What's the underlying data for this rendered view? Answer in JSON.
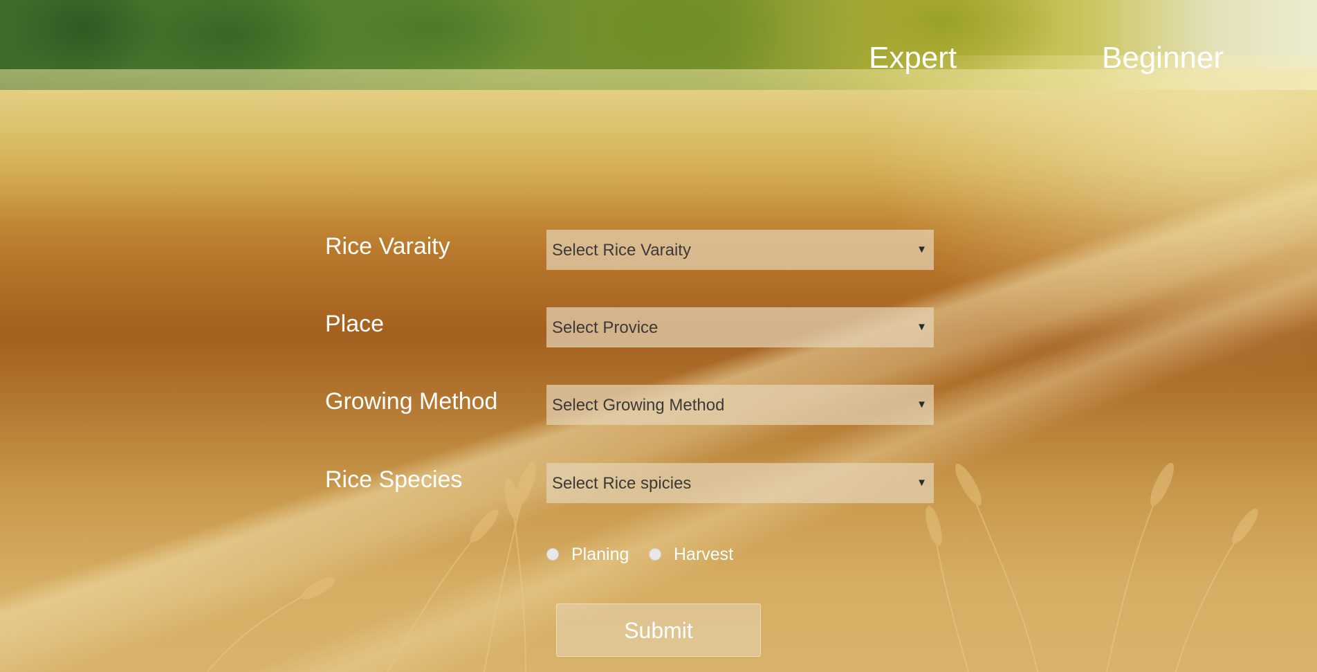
{
  "nav": {
    "expert": "Expert",
    "beginner": "Beginner"
  },
  "form": {
    "fields": [
      {
        "label": "Rice Varaity",
        "selected": "Select Rice Varaity"
      },
      {
        "label": "Place",
        "selected": "Select Provice"
      },
      {
        "label": "Growing Method",
        "selected": "Select Growing Method"
      },
      {
        "label": "Rice Species",
        "selected": "Select Rice spicies"
      }
    ],
    "radios": [
      {
        "label": "Planing",
        "checked": false
      },
      {
        "label": "Harvest",
        "checked": false
      }
    ],
    "submit_label": "Submit"
  },
  "icons": {
    "dropdown": "chevron-down-icon",
    "radio": "radio-circle-icon"
  },
  "colors": {
    "text": "#ffffff",
    "select_bg": "#e4d2b4",
    "select_text": "#3c3a36"
  }
}
